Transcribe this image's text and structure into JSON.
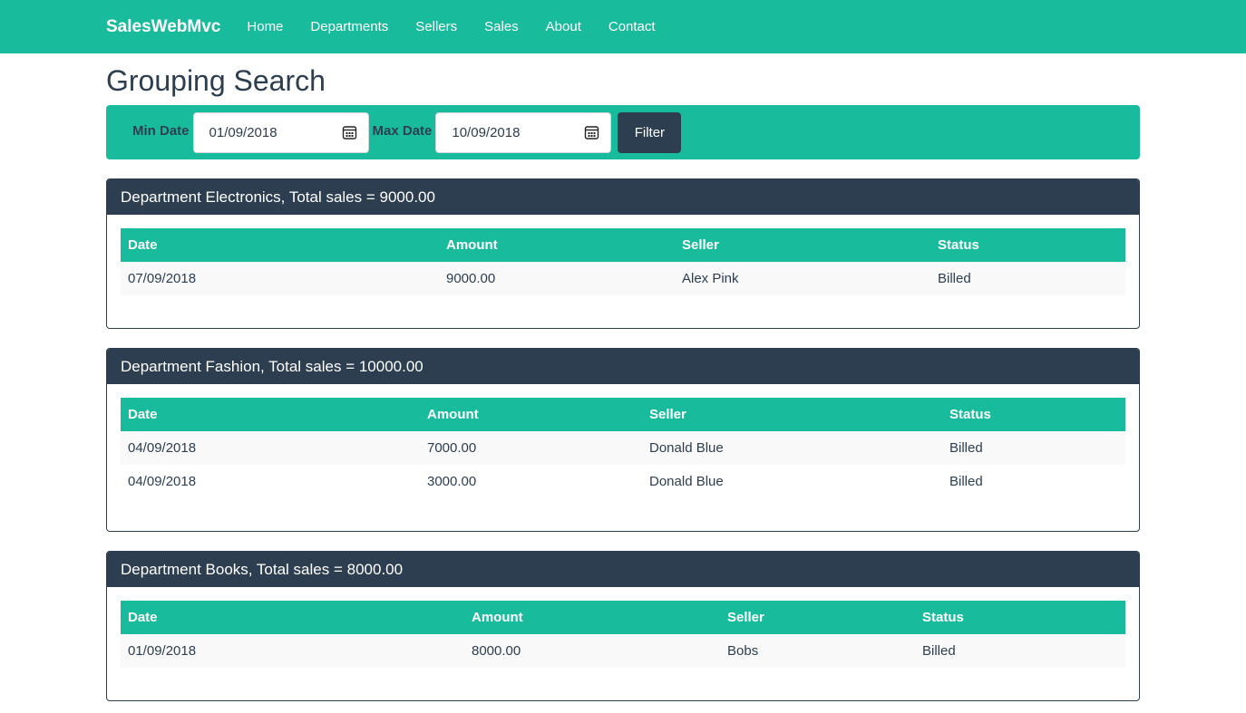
{
  "nav": {
    "brand": "SalesWebMvc",
    "links": [
      "Home",
      "Departments",
      "Sellers",
      "Sales",
      "About",
      "Contact"
    ]
  },
  "page": {
    "title": "Grouping Search"
  },
  "filter": {
    "min_label": "Min Date",
    "min_value": "01/09/2018",
    "max_label": "Max Date",
    "max_value": "10/09/2018",
    "button": "Filter"
  },
  "table_headers": [
    "Date",
    "Amount",
    "Seller",
    "Status"
  ],
  "groups": [
    {
      "heading": "Department Electronics, Total sales = 9000.00",
      "rows": [
        [
          "07/09/2018",
          "9000.00",
          "Alex Pink",
          "Billed"
        ]
      ]
    },
    {
      "heading": "Department Fashion, Total sales = 10000.00",
      "rows": [
        [
          "04/09/2018",
          "7000.00",
          "Donald Blue",
          "Billed"
        ],
        [
          "04/09/2018",
          "3000.00",
          "Donald Blue",
          "Billed"
        ]
      ]
    },
    {
      "heading": "Department Books, Total sales = 8000.00",
      "rows": [
        [
          "01/09/2018",
          "8000.00",
          "Bobs",
          "Billed"
        ]
      ]
    }
  ]
}
